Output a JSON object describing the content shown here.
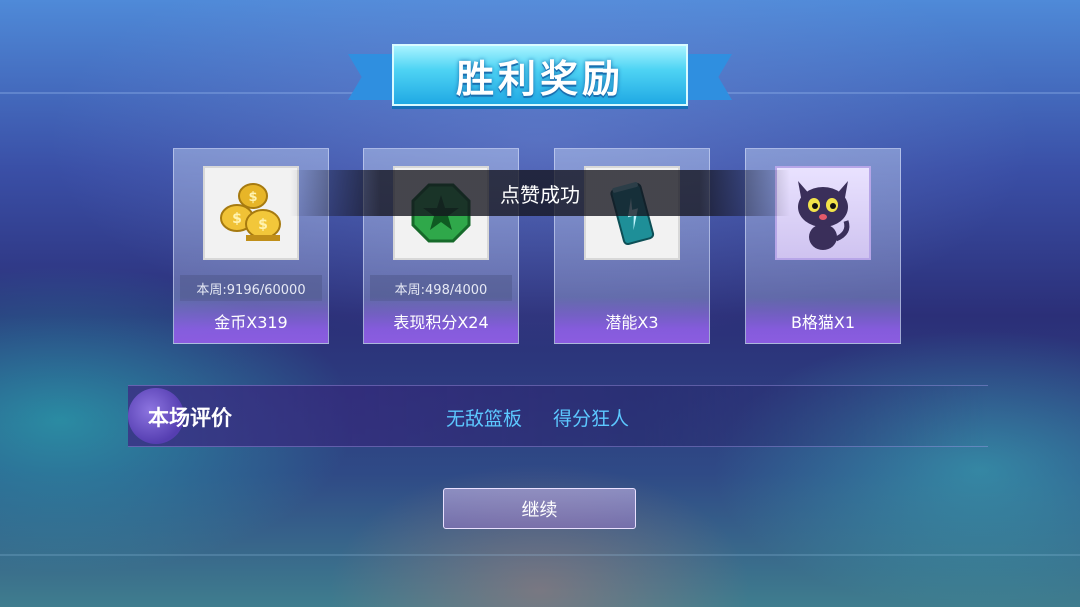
{
  "title": "胜利奖励",
  "toast": "点赞成功",
  "rewards": [
    {
      "label": "金币X319",
      "weekly": "本周:9196/60000",
      "icon": "gold-coins-icon"
    },
    {
      "label": "表现积分X24",
      "weekly": "本周:498/4000",
      "icon": "green-star-medal-icon"
    },
    {
      "label": "潜能X3",
      "icon": "energy-drink-can-icon"
    },
    {
      "label": "B格猫X1",
      "icon": "black-cat-icon"
    }
  ],
  "evaluation": {
    "heading": "本场评价",
    "tags": [
      "无敌篮板",
      "得分狂人"
    ]
  },
  "continue_label": "继续",
  "colors": {
    "banner": "#4fd4f4",
    "card_label": "#8b5ce0",
    "tag_text": "#5cc8ff"
  }
}
